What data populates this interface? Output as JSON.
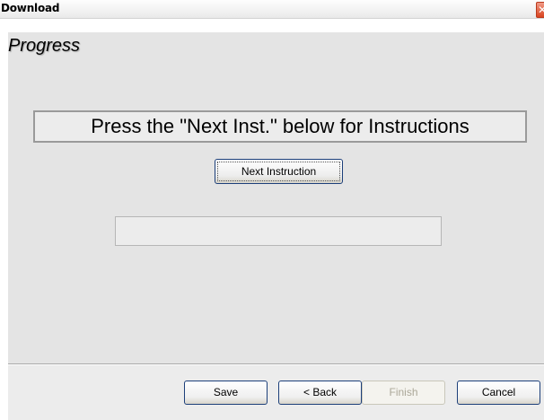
{
  "window": {
    "title": "Download",
    "close_glyph": "✕"
  },
  "page": {
    "heading": "Progress",
    "instruction": "Press the \"Next Inst.\" below for Instructions",
    "next_button_label": "Next Instruction",
    "progress_value": 0
  },
  "buttons": {
    "save": "Save",
    "back": "< Back",
    "finish": "Finish",
    "cancel": "Cancel"
  },
  "colors": {
    "button_border": "#1c3f7a",
    "close_button": "#d9441f",
    "disabled_text": "#aca899"
  }
}
